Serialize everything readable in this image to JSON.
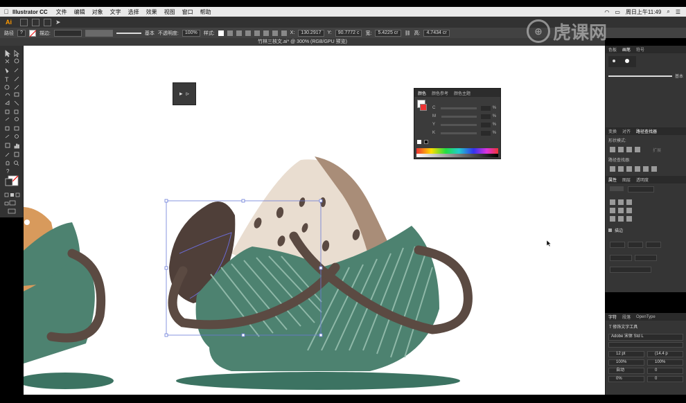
{
  "menubar": {
    "items": [
      "Illustrator CC",
      "文件",
      "编辑",
      "对象",
      "文字",
      "选择",
      "效果",
      "视图",
      "窗口",
      "帮助"
    ],
    "clock": "周日上午11:49"
  },
  "appbar": {
    "logo": "Ai"
  },
  "control": {
    "path_label": "路径",
    "stroke_label": "描边:",
    "stroke_style": "基本",
    "opacity_label": "不透明度:",
    "opacity_value": "100%",
    "style_label": "样式:",
    "x_label": "X:",
    "x_value": "130.2917",
    "y_label": "Y:",
    "y_value": "90.7772 c",
    "w_label": "宽:",
    "w_value": "5.4225 cr",
    "h_label": "高:",
    "h_value": "4.7434 cr"
  },
  "document": {
    "tab_title": "竹林三核文.ai* @ 300% (RGB/GPU 预览)"
  },
  "color_panel": {
    "tabs": [
      "颜色",
      "颜色参考",
      "颜色主题"
    ],
    "channels": [
      "C",
      "M",
      "Y",
      "K"
    ],
    "pct": "%"
  },
  "right_panel": {
    "top_tabs": [
      "色板",
      "画笔",
      "符号"
    ],
    "brush_name": "基本",
    "pathfinder_tabs": [
      "变换",
      "对齐",
      "路径查找器"
    ],
    "shape_modes_label": "形状模式:",
    "expand_label": "扩展",
    "pathfinder_label": "路径查找器:",
    "appearance_tabs": [
      "属性",
      "图层",
      "透明度"
    ],
    "stroke_section": "描边",
    "char_tabs": [
      "字符",
      "段落",
      "OpenType"
    ],
    "touch_type_label": "修饰文字工具",
    "font_name": "Adobe 宋体 Std L",
    "font_size": "12 pt",
    "leading": "(14.4 p",
    "vscale": "100%",
    "hscale": "100%",
    "kerning": "自动",
    "tracking": "0",
    "rotate": "0%",
    "baseline": "0"
  },
  "watermark": {
    "text": "虎课网"
  }
}
